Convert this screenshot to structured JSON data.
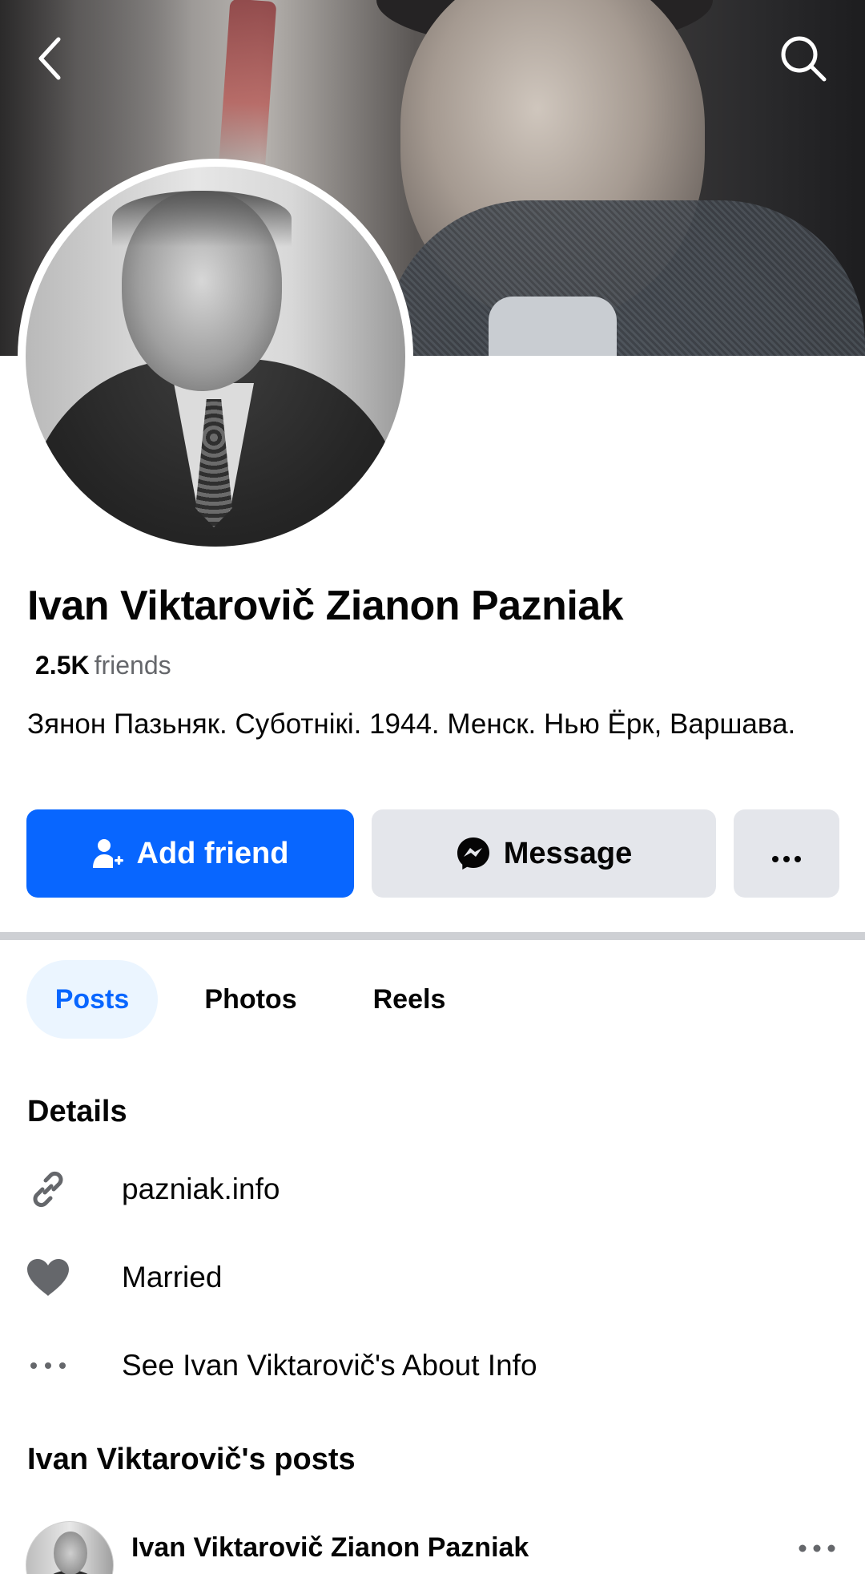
{
  "profile": {
    "name": "Ivan Viktarovič Zianon Pazniak",
    "friends_count": "2.5K",
    "friends_label": "friends",
    "bio": "Зянон Пазьняк. Суботнікі. 1944. Менск. Нью Ёрк, Варшава."
  },
  "actions": {
    "add_friend": "Add friend",
    "message": "Message",
    "more": "···"
  },
  "tabs": [
    {
      "label": "Posts",
      "active": true
    },
    {
      "label": "Photos",
      "active": false
    },
    {
      "label": "Reels",
      "active": false
    }
  ],
  "details": {
    "title": "Details",
    "items": [
      {
        "icon": "link-icon",
        "text": "pazniak.info"
      },
      {
        "icon": "heart-icon",
        "text": "Married"
      },
      {
        "icon": "more-dots-icon",
        "text": "See Ivan Viktarovič's About Info"
      }
    ]
  },
  "posts_section": {
    "title": "Ivan Viktarovič's posts",
    "first_post_author": "Ivan Viktarovič Zianon Pazniak"
  },
  "colors": {
    "primary": "#0866ff",
    "secondary_button": "#e4e6eb",
    "active_tab_bg": "#ebf5ff",
    "muted_text": "#65676b",
    "icon_gray": "#65676b"
  }
}
